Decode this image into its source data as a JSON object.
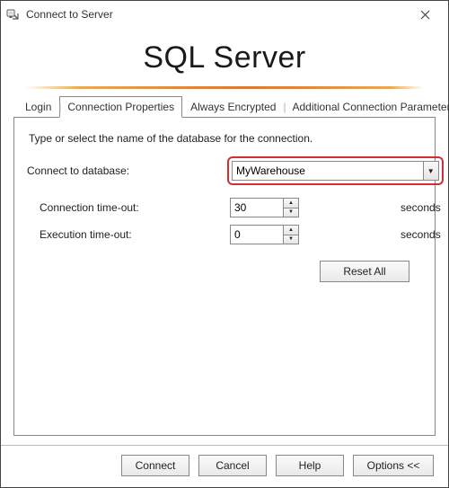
{
  "window": {
    "title": "Connect to Server"
  },
  "logo_text": "SQL Server",
  "tabs": {
    "login": "Login",
    "conn_props": "Connection Properties",
    "always_encrypted": "Always Encrypted",
    "additional_params": "Additional Connection Parameters"
  },
  "panel": {
    "instruction": "Type or select the name of the database for the connection.",
    "connect_label": "Connect to database:",
    "connect_value": "MyWarehouse",
    "conn_timeout_label": "Connection time-out:",
    "conn_timeout_value": "30",
    "exec_timeout_label": "Execution time-out:",
    "exec_timeout_value": "0",
    "unit_seconds_1": "seconds",
    "unit_seconds_2": "seconds",
    "reset_label": "Reset All"
  },
  "footer": {
    "connect": "Connect",
    "cancel": "Cancel",
    "help": "Help",
    "options": "Options <<"
  }
}
